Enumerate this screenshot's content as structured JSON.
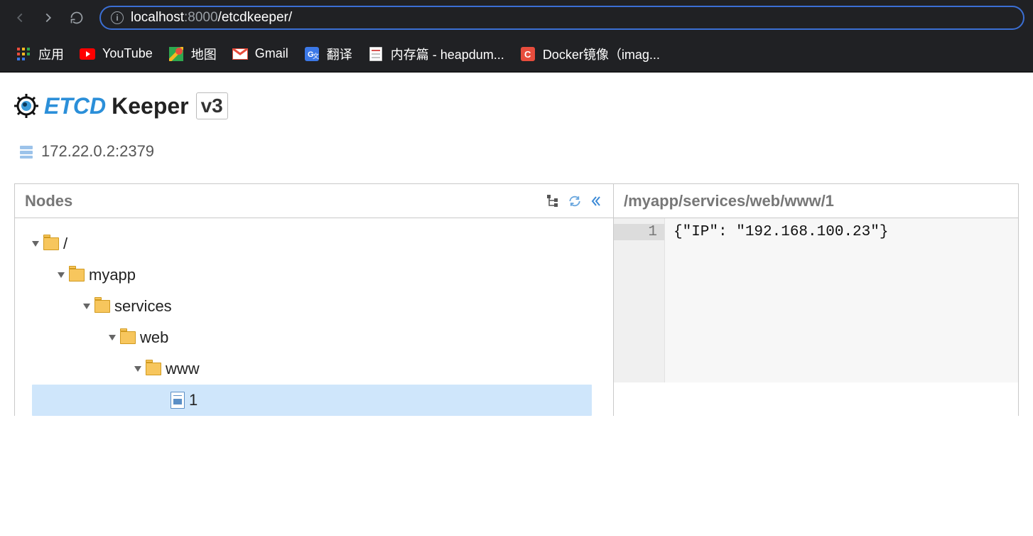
{
  "browser": {
    "url_host": "localhost",
    "url_port": ":8000",
    "url_path": "/etcdkeeper/"
  },
  "bookmarks": [
    {
      "label": "应用"
    },
    {
      "label": "YouTube"
    },
    {
      "label": "地图"
    },
    {
      "label": "Gmail"
    },
    {
      "label": "翻译"
    },
    {
      "label": "内存篇 - heapdum..."
    },
    {
      "label": "Docker镜像（imag..."
    }
  ],
  "app": {
    "title_etcd": "ETCD",
    "title_keeper": "Keeper",
    "version": "v3"
  },
  "server": {
    "address": "172.22.0.2:2379"
  },
  "left_panel_title": "Nodes",
  "tree": [
    {
      "level": 1,
      "icon": "folder",
      "label": "/"
    },
    {
      "level": 2,
      "icon": "folder",
      "label": "myapp"
    },
    {
      "level": 3,
      "icon": "folder",
      "label": "services"
    },
    {
      "level": 4,
      "icon": "folder",
      "label": "web"
    },
    {
      "level": 5,
      "icon": "folder",
      "label": "www"
    },
    {
      "level": 6,
      "icon": "file",
      "label": "1",
      "selected": true
    }
  ],
  "right_panel_title": "/myapp/services/web/www/1",
  "editor": {
    "lines": [
      {
        "num": "1",
        "text": "{\"IP\": \"192.168.100.23\"}"
      }
    ]
  }
}
